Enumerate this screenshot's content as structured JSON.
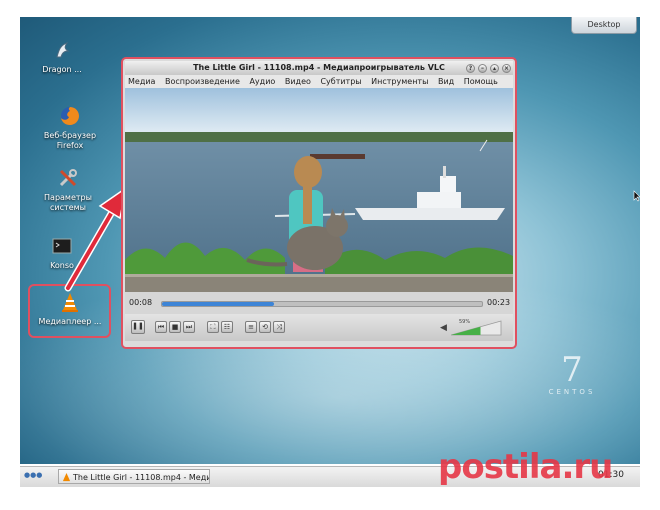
{
  "desktop": {
    "button_label": "Desktop",
    "icons": [
      {
        "label": "Dragon ...",
        "icon": "dragon-icon"
      },
      {
        "label": "Веб-браузер Firefox",
        "icon": "firefox-icon"
      },
      {
        "label": "Параметры системы",
        "icon": "settings-tools-icon"
      },
      {
        "label": "Konso",
        "icon": "terminal-icon"
      },
      {
        "label": "Медиаплеер ...",
        "icon": "vlc-cone-icon"
      }
    ],
    "centos": {
      "number": "7",
      "word": "CENTOS"
    }
  },
  "vlc": {
    "title": "The Little Girl - 11108.mp4 - Медиапроигрыватель VLC",
    "menu": [
      "Медиа",
      "Воспроизведение",
      "Аудио",
      "Видео",
      "Субтитры",
      "Инструменты",
      "Вид",
      "Помощь"
    ],
    "time_elapsed": "00:08",
    "time_total": "00:23",
    "progress": 0.35,
    "volume_label": "59%",
    "volume": 0.59
  },
  "taskbar": {
    "task_label": "The Little Girl - 11108.mp4 - Медиа",
    "clock": "01:30"
  },
  "watermark": "postila.ru"
}
